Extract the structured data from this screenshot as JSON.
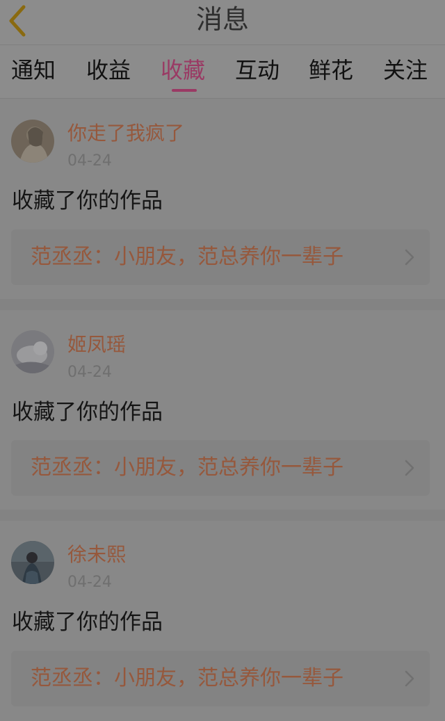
{
  "header": {
    "title": "消息"
  },
  "tabs": [
    {
      "label": "通知"
    },
    {
      "label": "收益"
    },
    {
      "label": "收藏"
    },
    {
      "label": "互动"
    },
    {
      "label": "鲜花"
    },
    {
      "label": "关注"
    }
  ],
  "active_tab": "收藏",
  "messages": [
    {
      "username": "你走了我疯了",
      "date": "04-24",
      "action": "收藏了你的作品",
      "work_title": "范丞丞：小朋友，范总养你一辈子"
    },
    {
      "username": "姬凤瑶",
      "date": "04-24",
      "action": "收藏了你的作品",
      "work_title": "范丞丞：小朋友，范总养你一辈子"
    },
    {
      "username": "徐未熙",
      "date": "04-24",
      "action": "收藏了你的作品",
      "work_title": "范丞丞：小朋友，范总养你一辈子"
    }
  ],
  "colors": {
    "accent": "#9a3a64",
    "username": "#96583c",
    "back_arrow": "#8a6a10"
  },
  "icons": {
    "back": "chevron-left-icon",
    "row_arrow": "chevron-right-icon"
  }
}
